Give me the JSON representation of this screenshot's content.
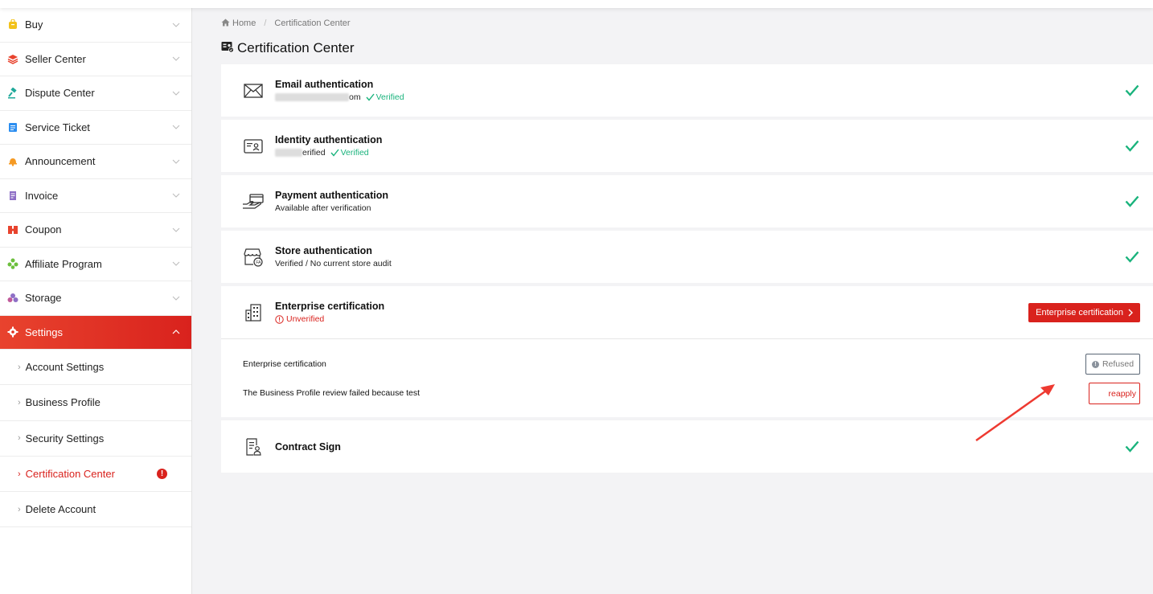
{
  "sidebar": {
    "items": [
      {
        "label": "Buy",
        "icon": "bag-icon"
      },
      {
        "label": "Seller Center",
        "icon": "layers-icon"
      },
      {
        "label": "Dispute Center",
        "icon": "gavel-icon"
      },
      {
        "label": "Service Ticket",
        "icon": "ticket-icon"
      },
      {
        "label": "Announcement",
        "icon": "bell-icon"
      },
      {
        "label": "Invoice",
        "icon": "invoice-icon"
      },
      {
        "label": "Coupon",
        "icon": "coupon-icon"
      },
      {
        "label": "Affiliate Program",
        "icon": "affiliate-icon"
      },
      {
        "label": "Storage",
        "icon": "storage-icon"
      },
      {
        "label": "Settings",
        "icon": "gear-icon"
      }
    ],
    "sub_items": [
      {
        "label": "Account Settings"
      },
      {
        "label": "Business Profile"
      },
      {
        "label": "Security Settings"
      },
      {
        "label": "Certification Center",
        "alert": "!"
      },
      {
        "label": "Delete Account"
      }
    ]
  },
  "breadcrumb": {
    "home": "Home",
    "current": "Certification Center"
  },
  "page": {
    "title": "Certification Center"
  },
  "cards": [
    {
      "title": "Email authentication",
      "sub_visible": "om",
      "status": "Verified"
    },
    {
      "title": "Identity authentication",
      "sub_visible": "erified",
      "status": "Verified"
    },
    {
      "title": "Payment authentication",
      "sub": "Available after verification"
    },
    {
      "title": "Store authentication",
      "sub": "Verified / No current store audit"
    },
    {
      "title": "Enterprise certification",
      "status": "Unverified",
      "button": "Enterprise certification"
    },
    {
      "title": "Contract Sign"
    }
  ],
  "detail": {
    "title": "Enterprise certification",
    "message": "The Business Profile review failed because test",
    "refused_label": "Refused",
    "reapply_label": "reapply"
  },
  "colors": {
    "accent": "#d9221d",
    "verified": "#19b37c"
  }
}
